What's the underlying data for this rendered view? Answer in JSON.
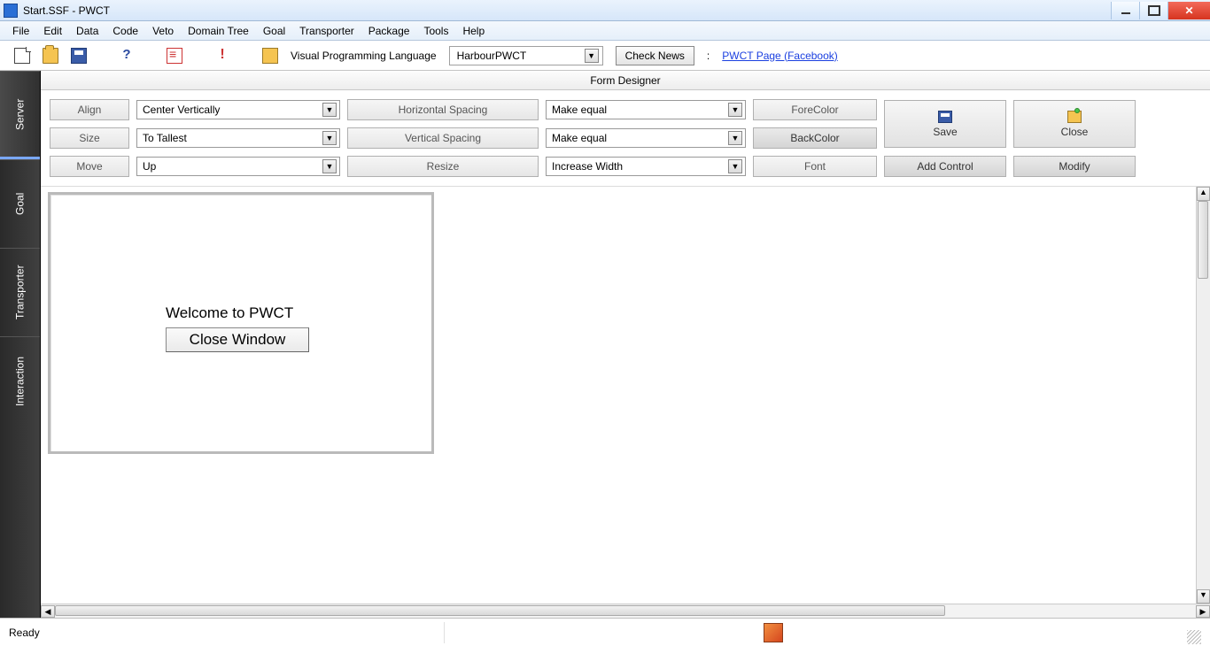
{
  "window": {
    "title": "Start.SSF  - PWCT"
  },
  "menu": {
    "items": [
      "File",
      "Edit",
      "Data",
      "Code",
      "Veto",
      "Domain Tree",
      "Goal",
      "Transporter",
      "Package",
      "Tools",
      "Help"
    ]
  },
  "toolbar": {
    "vpl_label": "Visual Programming Language",
    "vpl_selected": "HarbourPWCT",
    "check_news": "Check News",
    "colon": ":",
    "pwct_link": "PWCT Page (Facebook)"
  },
  "sidebar": {
    "tabs": [
      "Server",
      "Goal",
      "Transporter",
      "Interaction"
    ]
  },
  "designer": {
    "title": "Form Designer",
    "row1": {
      "btn": "Align",
      "sel": "Center Vertically",
      "btn2": "Horizontal Spacing",
      "sel2": "Make equal",
      "btnR": "ForeColor"
    },
    "row2": {
      "btn": "Size",
      "sel": "To Tallest",
      "btn2": "Vertical Spacing",
      "sel2": "Make equal",
      "btnR": "BackColor"
    },
    "row3": {
      "btn": "Move",
      "sel": "Up",
      "btn2": "Resize",
      "sel2": "Increase Width",
      "btnR": "Font"
    },
    "save": "Save",
    "close": "Close",
    "add_control": "Add Control",
    "modify": "Modify"
  },
  "form": {
    "welcome": "Welcome to PWCT",
    "close_window": "Close Window"
  },
  "status": {
    "ready": "Ready"
  }
}
